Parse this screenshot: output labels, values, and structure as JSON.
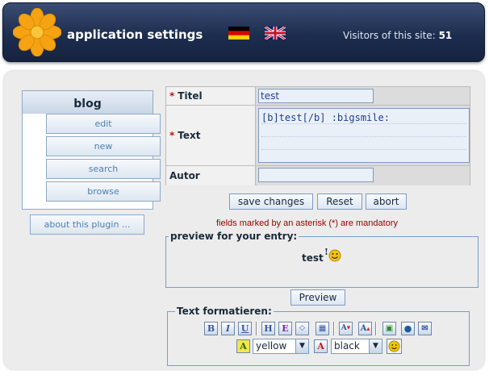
{
  "header": {
    "title": "application settings",
    "visitors_label": "Visitors of this site:",
    "visitors_count": "51",
    "lang_de": "German flag",
    "lang_en": "English flag"
  },
  "menu": {
    "title": "blog",
    "items": [
      "edit",
      "new",
      "search",
      "browse"
    ],
    "about": "about this plugin ..."
  },
  "form": {
    "fields": [
      {
        "label": "Titel",
        "required": true,
        "value": "test"
      },
      {
        "label": "Text",
        "required": true,
        "value": "[b]test[/b] :bigsmile:"
      },
      {
        "label": "Autor",
        "required": false,
        "value": ""
      }
    ],
    "asterisk": "*",
    "buttons": {
      "save": "save changes",
      "reset": "Reset",
      "abort": "abort"
    },
    "mandatory_note": "fields marked by an asterisk (*) are mandatory"
  },
  "preview": {
    "legend": "preview for your entry:",
    "content": "test",
    "button": "Preview"
  },
  "formatting": {
    "legend": "Text formatieren:",
    "tools": [
      "bold-icon",
      "italic-icon",
      "underline-icon",
      "heading-icon",
      "emphasis-icon",
      "code-icon",
      "table-icon",
      "font-bigger-icon",
      "font-smaller-icon",
      "image-icon",
      "globe-link-icon",
      "email-icon"
    ],
    "highlight_color": "yellow",
    "text_color": "black"
  },
  "colors": {
    "header": "#1d2d4f",
    "panel": "#ececec",
    "accent": "#7e9cbf",
    "mandatory": "#a00000"
  }
}
